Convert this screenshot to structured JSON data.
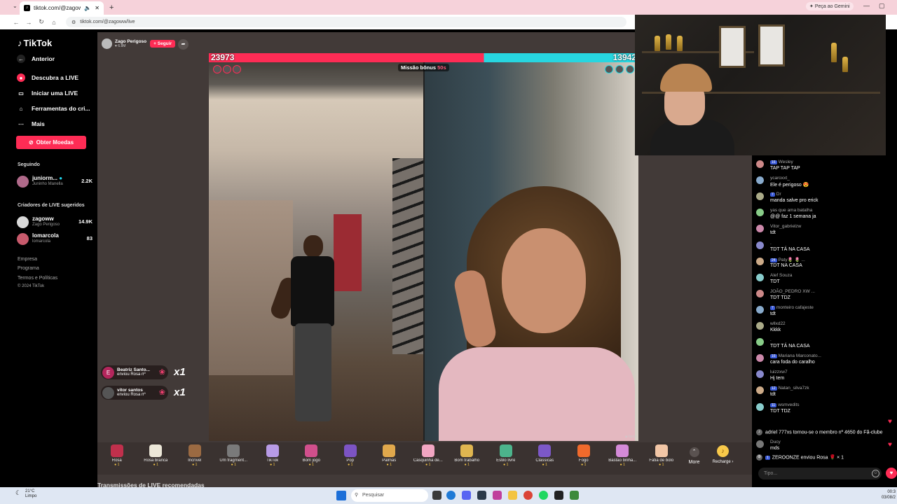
{
  "browser": {
    "tab_title": "tiktok.com/@zagoww/live",
    "url": "tiktok.com/@zagoww/live",
    "gemini_label": "Peça ao Gemini"
  },
  "sidebar": {
    "logo": "TikTok",
    "nav": [
      {
        "label": "Anterior",
        "icon": "back-arrow-icon"
      },
      {
        "label": "Descubra a LIVE",
        "icon": "live-icon"
      },
      {
        "label": "Iniciar uma LIVE",
        "icon": "camera-icon"
      },
      {
        "label": "Ferramentas do cri...",
        "icon": "home-icon"
      },
      {
        "label": "Mais",
        "icon": "more-icon"
      }
    ],
    "coins_button": "Obter Moedas",
    "following_heading": "Seguindo",
    "following": [
      {
        "name": "juniorm...",
        "sub": "Juninho Manella",
        "count": "2.2K"
      }
    ],
    "suggested_heading": "Criadores de LIVE sugeridos",
    "suggested": [
      {
        "name": "zagoww",
        "sub": "Zago Perigoso",
        "count": "14.9K"
      },
      {
        "name": "lomarcola",
        "sub": "lomarcola",
        "count": "83"
      }
    ],
    "footer": [
      "Empresa",
      "Programa",
      "Termos e Políticas",
      "© 2024 TikTok"
    ]
  },
  "live": {
    "host_name": "Zago Perigoso",
    "host_sub": "6.8M",
    "follow_label": "+ Seguir",
    "score_left": "23973",
    "score_right": "13942",
    "score_left_fraction": 0.64,
    "mission_label": "Missão bônus",
    "mission_time": "50s",
    "gift_notifications": [
      {
        "initial": "E",
        "name": "Beatriz Santo...",
        "action": "enviou Rosa nº",
        "count": "x1"
      },
      {
        "initial": "",
        "name": "vitor santos",
        "action": "enviou Rosa nº",
        "count": "x1"
      }
    ],
    "recommended_heading": "Transmissões de LIVE recomendadas"
  },
  "gifts": [
    {
      "name": "Rosa",
      "price": "1",
      "icon": "rose-icon",
      "color": "#c0304c"
    },
    {
      "name": "Rosa branca",
      "price": "1",
      "icon": "white-rose-icon",
      "color": "#ece7d8"
    },
    {
      "name": "Incrível",
      "price": "1",
      "icon": "dog-icon",
      "color": "#9b6a42"
    },
    {
      "name": "Um fragment...",
      "price": "1",
      "icon": "fragment-icon",
      "color": "#7a7a7a"
    },
    {
      "name": "TikTok",
      "price": "1",
      "icon": "tiktok-gift-icon",
      "color": "#b79be6"
    },
    {
      "name": "Bom jogo",
      "price": "1",
      "icon": "gamepad-icon",
      "color": "#d04f8c"
    },
    {
      "name": "Pop",
      "price": "1",
      "icon": "pop-icon",
      "color": "#7c54c4"
    },
    {
      "name": "Palmas",
      "price": "1",
      "icon": "clap-icon",
      "color": "#e0a84c"
    },
    {
      "name": "Casquinha de...",
      "price": "1",
      "icon": "ice-cream-icon",
      "color": "#f2a6c2"
    },
    {
      "name": "Bom trabalho",
      "price": "1",
      "icon": "thumbs-up-icon",
      "color": "#e0b650"
    },
    {
      "name": "Estilo livre",
      "price": "1",
      "icon": "freestyle-icon",
      "color": "#4cb48c"
    },
    {
      "name": "Clássicas",
      "price": "1",
      "icon": "classic-icon",
      "color": "#7c58c8"
    },
    {
      "name": "Fogo",
      "price": "1",
      "icon": "fire-icon",
      "color": "#f06a2c"
    },
    {
      "name": "Bastão brilha...",
      "price": "1",
      "icon": "glow-stick-icon",
      "color": "#d48ad8"
    },
    {
      "name": "Fatia de bolo",
      "price": "1",
      "icon": "cake-icon",
      "color": "#f2c6a6"
    }
  ],
  "gift_more": "More",
  "gift_recharge": "Recharge",
  "chat": {
    "messages": [
      {
        "badge": "16",
        "user": "Wesley",
        "text": "TAP TAP TAP"
      },
      {
        "badge": "",
        "user": "ycaroxxt_",
        "text": "Ele é perigoso 😍"
      },
      {
        "badge": "7",
        "user": "Dr",
        "text": "manda salve pro erick"
      },
      {
        "badge": "",
        "user": "yas que ama batalha",
        "text": "@@ faz 1 semana ja"
      },
      {
        "badge": "",
        "user": "Vitor_gabrielzw",
        "text": "tdt"
      },
      {
        "badge": "",
        "user": ".",
        "text": "TDT TÁ NA CASA"
      },
      {
        "badge": "24",
        "user": "Paty🌷 🌷 ...",
        "text": "TDT NA CASA"
      },
      {
        "badge": "",
        "user": "Alef Souza",
        "text": "TDT"
      },
      {
        "badge": "",
        "user": "JOÃO_PEDRO XW ...",
        "text": "TDT TDZ"
      },
      {
        "badge": "7",
        "user": "monteiro cafajeste",
        "text": "tdt"
      },
      {
        "badge": "",
        "user": "wllxd22",
        "text": "Kkkk"
      },
      {
        "badge": "",
        "user": ".",
        "text": "TDT TÁ NA CASA"
      },
      {
        "badge": "16",
        "user": "Mariana Marconato...",
        "text": "cara foda do caralho"
      },
      {
        "badge": "",
        "user": "luizzxw7",
        "text": "Hj tem"
      },
      {
        "badge": "12",
        "user": "Natan_silva7zk",
        "text": "tdt"
      },
      {
        "badge": "11",
        "user": "wsmvedits",
        "text": "TDT TDZ"
      }
    ],
    "system_1": "adriel 777xs tornou-se o membro nº 4650 do Fã-clube",
    "system_2_user": "Ducy",
    "system_2_text": "mds",
    "system_3": "ZEROONZE enviou Rosa 🌹 × 1",
    "system_3_badge": "1",
    "input_placeholder": "Tipo..."
  },
  "taskbar": {
    "temp": "21°C",
    "weather": "Limpo",
    "search": "Pesquisar",
    "time": "00:3",
    "date": "03/08/2"
  },
  "colors": {
    "accent": "#fe2c55",
    "opponent": "#27d6e0"
  }
}
